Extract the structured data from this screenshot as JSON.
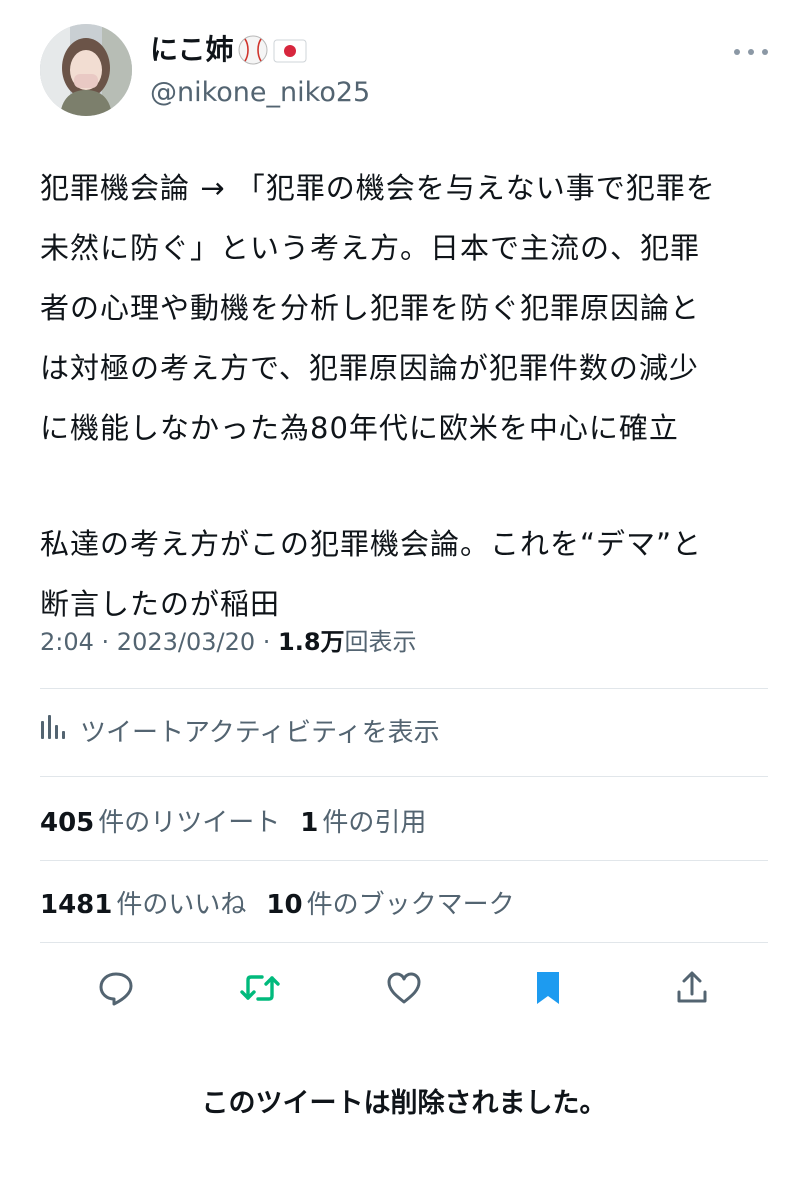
{
  "author": {
    "display_name": "にこ姉",
    "handle": "@nikone_niko25",
    "badges": [
      "baseball-icon",
      "japan-flag-icon"
    ]
  },
  "tweet": {
    "lines": [
      "犯罪機会論 → 「犯罪の機会を与えない事で犯罪を",
      "未然に防ぐ」という考え方。日本で主流の、犯罪",
      "者の心理や動機を分析し犯罪を防ぐ犯罪原因論と",
      "は対極の考え方で、犯罪原因論が犯罪件数の減少",
      "に機能しなかった為80年代に欧米を中心に確立",
      "",
      "私達の考え方がこの犯罪機会論。これを“デマ”と",
      "断言したのが稲田"
    ]
  },
  "meta": {
    "time": "2:04",
    "sep1": " · ",
    "date": "2023/03/20",
    "sep2": " · ",
    "views_number": "1.8万",
    "views_label": "回表示"
  },
  "activity_label": "ツイートアクティビティを表示",
  "stats": {
    "retweets_number": "405",
    "retweets_label": "件のリツイート",
    "quotes_number": "1",
    "quotes_label": "件の引用",
    "likes_number": "1481",
    "likes_label": "件のいいね",
    "bookmarks_number": "10",
    "bookmarks_label": "件のブックマーク"
  },
  "actions": {
    "icons": [
      "reply-icon",
      "retweet-icon",
      "like-icon",
      "bookmark-icon",
      "share-icon"
    ],
    "colors": {
      "default": "#536471",
      "retweet": "#00ba7c",
      "bookmark": "#1d9bf0"
    }
  },
  "deleted_notice": "このツイートは削除されました。"
}
